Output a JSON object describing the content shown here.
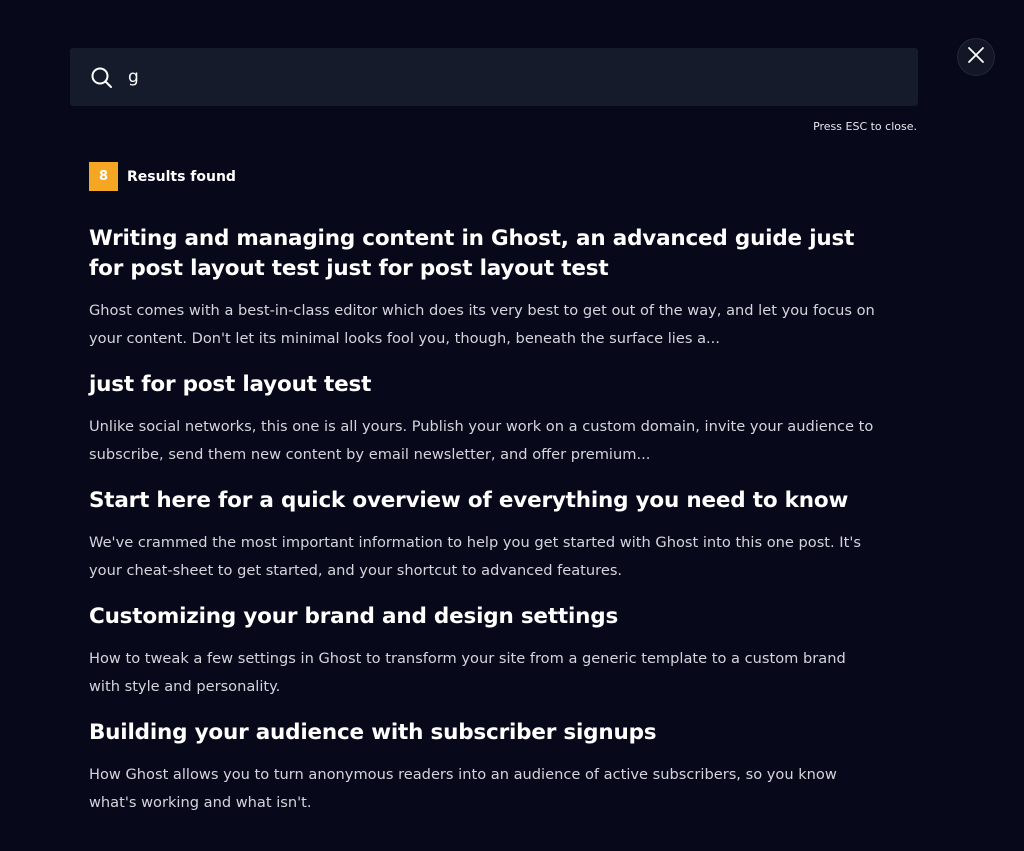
{
  "search": {
    "value": "g",
    "esc_hint": "Press ESC to close."
  },
  "results_header": {
    "count": "8",
    "label": "Results found"
  },
  "results": [
    {
      "title": "Writing and managing content in Ghost, an advanced guide just for post layout test just for post layout test",
      "excerpt": "Ghost comes with a best-in-class editor which does its very best to get out of the way, and let you focus on your content. Don't let its minimal looks fool you, though, beneath the surface lies a..."
    },
    {
      "title": "just for post layout test",
      "excerpt": "Unlike social networks, this one is all yours. Publish your work on a custom domain, invite your audience to subscribe, send them new content by email newsletter, and offer premium..."
    },
    {
      "title": "Start here for a quick overview of everything you need to know",
      "excerpt": "We've crammed the most important information to help you get started with Ghost into this one post. It's your cheat-sheet to get started, and your shortcut to advanced features."
    },
    {
      "title": "Customizing your brand and design settings",
      "excerpt": "How to tweak a few settings in Ghost to transform your site from a generic template to a custom brand with style and personality."
    },
    {
      "title": "Building your audience with subscriber signups",
      "excerpt": "How Ghost allows you to turn anonymous readers into an audience of active subscribers, so you know what's working and what isn't."
    }
  ],
  "icons": {
    "search": "search-icon",
    "close": "close-icon"
  },
  "colors": {
    "background": "#07081a",
    "search_bg": "#151b2b",
    "badge": "#f5a623"
  }
}
